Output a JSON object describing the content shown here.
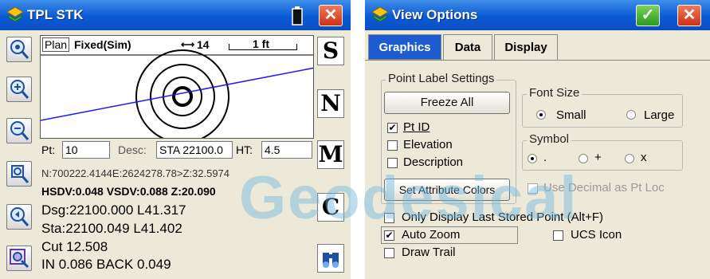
{
  "left_window": {
    "title": "TPL STK",
    "close_label": "✕",
    "side_buttons": [
      "S",
      "N",
      "M",
      "C"
    ],
    "map": {
      "mode": "Plan",
      "status": "Fixed(Sim)",
      "satellites": "14",
      "scale": "1 ft"
    },
    "fields": {
      "pt_label": "Pt:",
      "pt_value": "10",
      "desc_label": "Desc:",
      "desc_value": "STA 22100.0",
      "ht_label": "HT:",
      "ht_value": "4.5"
    },
    "readouts": [
      "N:700222.4144E:2624278.78>Z:32.5974",
      "HSDV:0.048 VSDV:0.088 Z:20.090",
      "Dsg:22100.000 L41.317",
      "Sta:22100.049 L41.402",
      "Cut 12.508",
      "IN 0.086 BACK 0.049"
    ]
  },
  "right_window": {
    "title": "View Options",
    "ok_label": "✓",
    "close_label": "✕",
    "tabs": [
      "Graphics",
      "Data",
      "Display"
    ],
    "active_tab": "Graphics",
    "point_label_group": "Point Label Settings",
    "freeze_button": "Freeze All",
    "checks": [
      {
        "label": "Pt ID",
        "checked": true
      },
      {
        "label": "Elevation",
        "checked": false
      },
      {
        "label": "Description",
        "checked": false
      }
    ],
    "attr_button": "Set Attribute Colors",
    "font_size_group": "Font Size",
    "font_options": [
      {
        "label": "Small",
        "selected": true
      },
      {
        "label": "Large",
        "selected": false
      }
    ],
    "symbol_group": "Symbol",
    "symbol_options": [
      {
        "label": ".",
        "selected": true
      },
      {
        "label": "+",
        "selected": false
      },
      {
        "label": "x",
        "selected": false
      }
    ],
    "decimal_check": {
      "label": "Use Decimal as Pt Loc",
      "checked": false
    },
    "bottom_checks": [
      {
        "label": "Only Display Last Stored Point (Alt+F)",
        "checked": false
      },
      {
        "label": "Auto Zoom",
        "checked": true
      },
      {
        "label": "Draw Trail",
        "checked": false
      },
      {
        "label": "UCS Icon",
        "checked": false
      }
    ]
  },
  "watermark": "Geodesical",
  "colors": {
    "titlebar": "#0a5ad6",
    "close": "#d22e10",
    "ok": "#2b9a1c",
    "watermark": "#6fb7e0",
    "line": "#1a1aff"
  }
}
